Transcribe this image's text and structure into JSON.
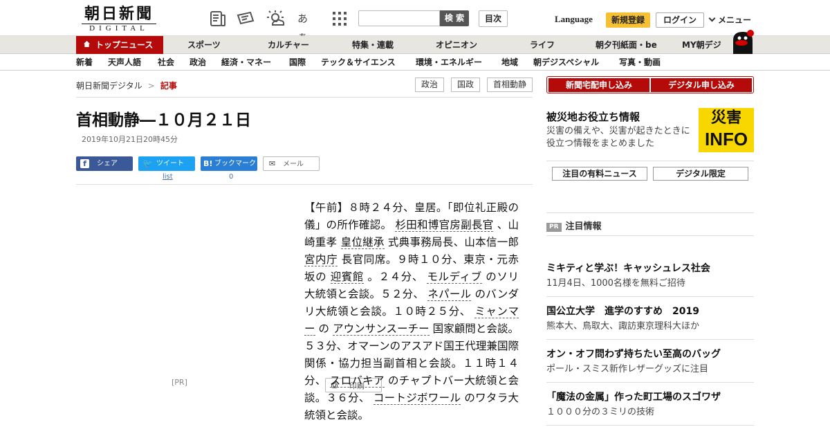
{
  "header": {
    "logo_line1": "朝日新聞",
    "logo_line2": "DIGITAL",
    "search_button": "検 索",
    "search_placeholder": "",
    "toc_button": "目次",
    "language": "Language",
    "register": "新規登録",
    "login": "ログイン",
    "menu": "メニュー",
    "text_size_icon_label": "あぁ"
  },
  "nav_primary": [
    "トップニュース",
    "スポーツ",
    "カルチャー",
    "特集・連載",
    "オピニオン",
    "ライフ",
    "朝夕刊紙面・be",
    "MY朝デジ"
  ],
  "nav_secondary": [
    "新着",
    "天声人語",
    "社会",
    "政治",
    "経済・マネー",
    "国際",
    "テック＆サイエンス",
    "環境・エネルギー",
    "地域",
    "朝デジスペシャル",
    "写真・動画"
  ],
  "breadcrumb": {
    "home": "朝日新聞デジタル",
    "sep": ">",
    "current": "記事"
  },
  "tags": [
    "政治",
    "国政",
    "首相動静"
  ],
  "article": {
    "title": "首相動静―１０月２１日",
    "date": "2019年10月21日20時45分",
    "share": {
      "facebook": "シェア",
      "twitter": "ツイート",
      "hatena": "ブックマーク",
      "mail": "メール",
      "print": "印刷"
    },
    "twitter_count": "list",
    "hatena_count": "0",
    "pr_label": "[PR]",
    "body": [
      {
        "t": "【午前】８時２４分、皇居。「即位礼正殿の儀」の所作確認。 "
      },
      {
        "t": "杉田和博官房副長官",
        "link": true
      },
      {
        "t": " 、山崎重孝 "
      },
      {
        "t": "皇位継承",
        "link": true
      },
      {
        "t": " 式典事務局長、山本信一郎 "
      },
      {
        "t": "宮内庁",
        "link": true
      },
      {
        "t": " 長官同席。９時１０分、東京・元赤坂の "
      },
      {
        "t": "迎賓館",
        "link": true
      },
      {
        "t": " 。２４分、 "
      },
      {
        "t": "モルディブ",
        "link": true
      },
      {
        "t": " のソリ大統領と会談。５２分、 "
      },
      {
        "t": "ネパール",
        "link": true
      },
      {
        "t": " のバンダリ大統領と会談。１０時２５分、 "
      },
      {
        "t": "ミャンマー",
        "link": true
      },
      {
        "t": " の "
      },
      {
        "t": "アウンサンスーチー",
        "link": true
      },
      {
        "t": " 国家顧問と会談。５３分、オマーンのアスアド国王代理兼国際関係・協力担当副首相と会談。１１時１４分、 "
      },
      {
        "t": "スロバキア",
        "link": true
      },
      {
        "t": " のチャプトバー大統領と会談。３６分、 "
      },
      {
        "t": "コートジボワール",
        "link": true
      },
      {
        "t": " のワタラ大統領と会談。"
      }
    ]
  },
  "sidebar": {
    "subscribe_home": "新聞宅配申し込み",
    "subscribe_digital": "デジタル申し込み",
    "disaster_title": "被災地お役立ち情報",
    "disaster_desc": "災害の備えや、災害が起きたときに役立つ情報をまとめました",
    "disaster_banner_1": "災害",
    "disaster_banner_2": "INFO",
    "tab_paid": "注目の有料ニュース",
    "tab_digital": "デジタル限定",
    "pr_badge": "PR",
    "pr_title": "注目情報",
    "pr_items": [
      {
        "title": "ミキティと学ぶ！キャッシュレス社会",
        "desc": "11月4日、1000名様を無料ご招待"
      },
      {
        "title": "国公立大学　進学のすすめ　2019",
        "desc": "熊本大、鳥取大、諏訪東京理科大ほか"
      },
      {
        "title": "オン・オフ問わず持ちたい至高のバッグ",
        "desc": "ポール・スミス新作レザーグッズに注目"
      },
      {
        "title": "「魔法の金属」作った町工場のスゴワザ",
        "desc": "１０００分の３ミリの技術"
      }
    ]
  },
  "colors": {
    "brand_red": "#b40a0a",
    "accent_yellow": "#f5c132",
    "disaster_yellow": "#f8d700"
  }
}
